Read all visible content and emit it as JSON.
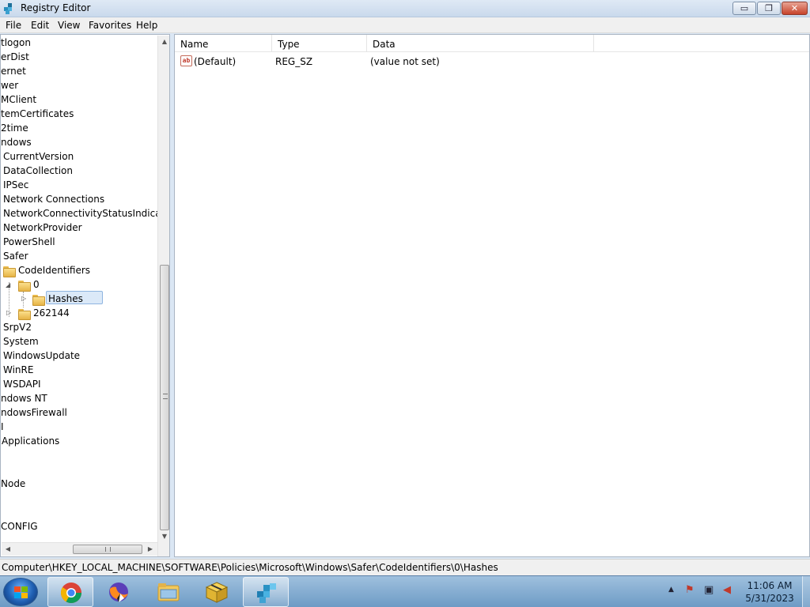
{
  "window": {
    "title": "Registry Editor",
    "minimize": "▭",
    "maximize": "❐",
    "close": "✕"
  },
  "menu": [
    "File",
    "Edit",
    "View",
    "Favorites",
    "Help"
  ],
  "tree": {
    "items": [
      "tlogon",
      "erDist",
      "ernet",
      "wer",
      "MClient",
      "temCertificates",
      "2time",
      "ndows",
      "CurrentVersion",
      "DataCollection",
      "IPSec",
      "Network Connections",
      "NetworkConnectivityStatusIndicator",
      "NetworkProvider",
      "PowerShell",
      "Safer",
      "CodeIdentifiers",
      "0",
      "Hashes",
      "262144",
      "SrpV2",
      "System",
      "WindowsUpdate",
      "WinRE",
      "WSDAPI",
      "ndows NT",
      "ndowsFirewall",
      "I",
      "Applications",
      "Node",
      "CONFIG"
    ],
    "selected": "Hashes"
  },
  "list": {
    "columns": [
      "Name",
      "Type",
      "Data"
    ],
    "rows": [
      {
        "name": "(Default)",
        "type": "REG_SZ",
        "data": "(value not set)",
        "icon": "ab"
      }
    ]
  },
  "status": {
    "path": "Computer\\HKEY_LOCAL_MACHINE\\SOFTWARE\\Policies\\Microsoft\\Windows\\Safer\\CodeIdentifiers\\0\\Hashes"
  },
  "taskbar": {
    "apps": [
      "chrome-icon",
      "firefox-icon",
      "file-explorer-icon",
      "package-icon",
      "registry-editor-icon"
    ],
    "clock": {
      "time": "11:06 AM",
      "date": "5/31/2023"
    }
  },
  "colors": {
    "selection": "#dbe9f8",
    "taskbar": "#6d9bc5"
  }
}
